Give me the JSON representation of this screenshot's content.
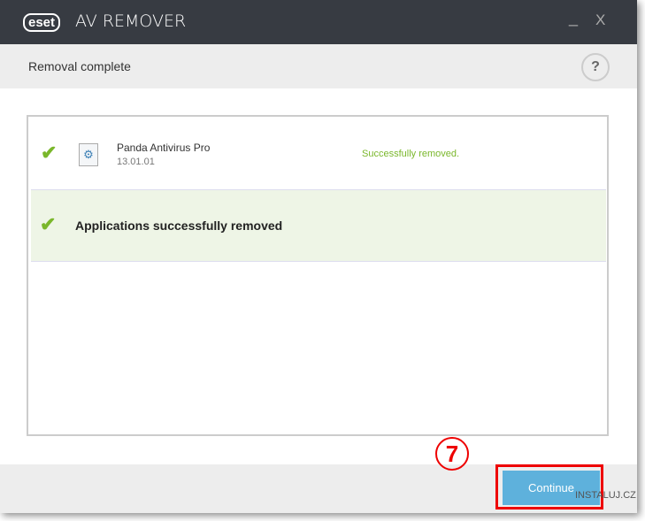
{
  "window": {
    "logo": "eset",
    "title": "AV REMOVER",
    "minimize": "_",
    "close": "X"
  },
  "header": {
    "title": "Removal complete",
    "help": "?"
  },
  "items": [
    {
      "name": "Panda Antivirus Pro",
      "version": "13.01.01",
      "status": "Successfully removed."
    }
  ],
  "summary": "Applications successfully removed",
  "footer": {
    "continue": "Continue"
  },
  "annotation": {
    "step": "7",
    "watermark": "INSTALUJ.CZ"
  },
  "colors": {
    "accent": "#5eb1dc",
    "success": "#7ab72b",
    "titlebar": "#373b42"
  }
}
